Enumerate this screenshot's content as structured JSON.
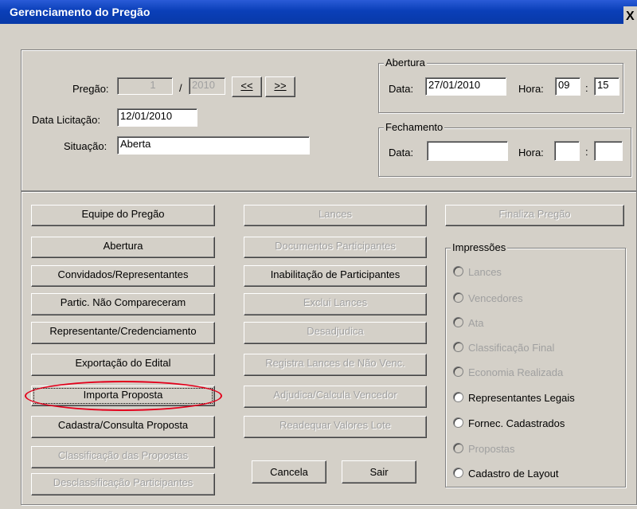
{
  "window": {
    "title": "Gerenciamento do Pregão",
    "close_label": "X"
  },
  "header": {
    "pregao_label": "Pregão:",
    "pregao_number": "1",
    "pregao_sep": "/",
    "pregao_year": "2010",
    "prev_label": "<<",
    "next_label": ">>",
    "data_licitacao_label": "Data Licitação:",
    "data_licitacao": "12/01/2010",
    "situacao_label": "Situação:",
    "situacao": "Aberta"
  },
  "abertura": {
    "title": "Abertura",
    "data_label": "Data:",
    "data": "27/01/2010",
    "hora_label": "Hora:",
    "hora": "09",
    "colon": ":",
    "minuto": "15"
  },
  "fechamento": {
    "title": "Fechamento",
    "data_label": "Data:",
    "data": "",
    "hora_label": "Hora:",
    "hora": "",
    "colon": ":",
    "minuto": ""
  },
  "buttons_left": [
    "Equipe do Pregão",
    "Abertura",
    "Convidados/Representantes",
    "Partic. Não Compareceram",
    "Representante/Credenciamento",
    "Exportação do Edital",
    "Importa Proposta",
    "Cadastra/Consulta Proposta",
    "Classificação das Propostas",
    "Desclassificação Participantes"
  ],
  "buttons_middle": [
    "Lances",
    "Documentos Participantes",
    "Inabilitação de Participantes",
    "Exclui Lances",
    "Desadjudica",
    "Registra Lances de Não Venc.",
    "Adjudica/Calcula Vencedor",
    "Readequar Valores Lote"
  ],
  "actions": {
    "cancela": "Cancela",
    "sair": "Sair"
  },
  "finaliza": "Finaliza Pregão",
  "impressoes": {
    "title": "Impressões",
    "options": [
      "Lances",
      "Vencedores",
      "Ata",
      "Classificação Final",
      "Economia Realizada",
      "Representantes Legais",
      "Fornec. Cadastrados",
      "Propostas",
      "Cadastro de Layout"
    ]
  }
}
